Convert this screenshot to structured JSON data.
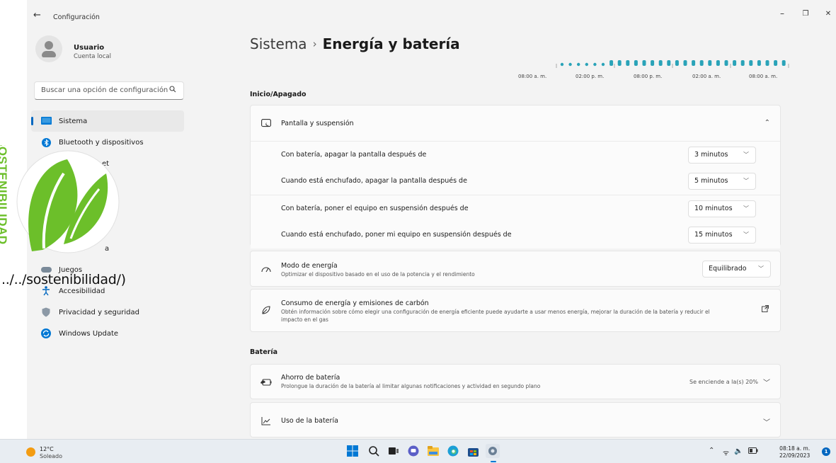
{
  "window": {
    "title": "Configuración",
    "back_glyph": "←",
    "minimize_glyph": "–",
    "restore_glyph": "❐",
    "close_glyph": "✕"
  },
  "profile": {
    "name": "Usuario",
    "subtitle": "Cuenta local"
  },
  "search": {
    "placeholder": "Buscar una opción de configuración"
  },
  "sidebar": {
    "items": [
      {
        "label": "Sistema",
        "icon": "system-icon"
      },
      {
        "label": "Bluetooth y dispositivos",
        "icon": "bluetooth-icon"
      },
      {
        "label": "et",
        "icon": "network-icon"
      },
      {
        "label": "",
        "icon": "personalization-icon"
      },
      {
        "label": "",
        "icon": "apps-icon"
      },
      {
        "label": "",
        "icon": "accounts-icon"
      },
      {
        "label": "a",
        "icon": "time-language-icon"
      },
      {
        "label": "Juegos",
        "icon": "gaming-icon"
      },
      {
        "label": "Accesibilidad",
        "icon": "accessibility-icon"
      },
      {
        "label": "Privacidad y seguridad",
        "icon": "shield-icon"
      },
      {
        "label": "Windows Update",
        "icon": "update-icon"
      }
    ]
  },
  "breadcrumb": {
    "parent": "Sistema",
    "separator": "›",
    "current": "Energía y batería"
  },
  "battery_graph": {
    "times": [
      "08:00 a. m.",
      "02:00 p. m.",
      "08:00 p. m.",
      "02:00 a. m.",
      "08:00 a. m."
    ]
  },
  "sections": {
    "power": "Inicio/Apagado",
    "battery": "Batería"
  },
  "screen_sleep": {
    "title": "Pantalla y suspensión",
    "rows": [
      {
        "label": "Con batería, apagar la pantalla después de",
        "value": "3 minutos"
      },
      {
        "label": "Cuando está enchufado, apagar la pantalla después de",
        "value": "5 minutos"
      },
      {
        "label": "Con batería, poner el equipo en suspensión después de",
        "value": "10 minutos"
      },
      {
        "label": "Cuando está enchufado, poner mi equipo en suspensión después de",
        "value": "15 minutos"
      }
    ]
  },
  "power_mode": {
    "title": "Modo de energía",
    "subtitle": "Optimizar el dispositivo basado en el uso de la potencia y el rendimiento",
    "value": "Equilibrado"
  },
  "carbon": {
    "title": "Consumo de energía y emisiones de carbón",
    "subtitle_line1": "Obtén información sobre cómo elegir una configuración de energía eficiente puede ayudarte a usar menos energía, mejorar la duración de la batería y reducir el",
    "subtitle_line2": "impacto en el gas"
  },
  "battery_saver": {
    "title": "Ahorro de batería",
    "subtitle": "Prolongue la duración de la batería al limitar algunas notificaciones y actividad en segundo plano",
    "status": "Se enciende a la(s) 20%"
  },
  "battery_usage": {
    "title": "Uso de la batería"
  },
  "overlay": {
    "logo_text": "SOSTENIBILIDAD",
    "url_text": "../../sostenibilidad/)"
  },
  "taskbar": {
    "temperature": "12°C",
    "condition": "Soleado",
    "time": "08:18 a. m.",
    "date": "22/09/2023",
    "notification_count": "1"
  },
  "colors": {
    "accent": "#0067c0",
    "graph": "#2aa3b8",
    "leaf_green": "#6cbf2a"
  }
}
